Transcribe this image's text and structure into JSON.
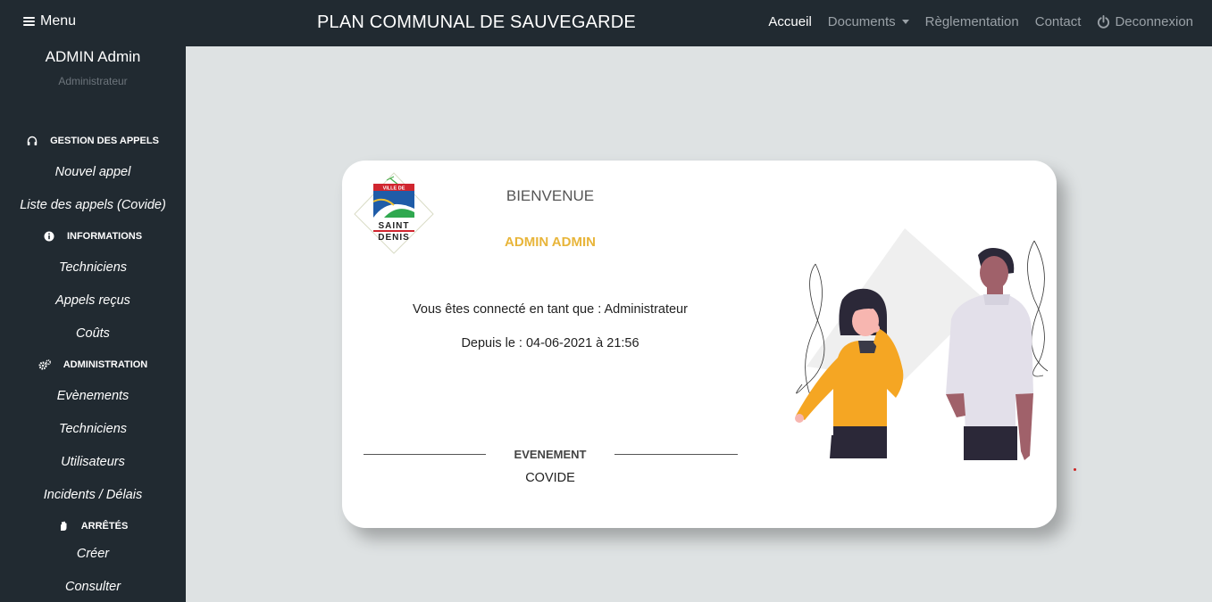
{
  "navbar": {
    "menu_label": "Menu",
    "brand": "PLAN COMMUNAL DE SAUVEGARDE",
    "links": {
      "home": "Accueil",
      "documents": "Documents",
      "regulation": "Règlementation",
      "contact": "Contact",
      "logout": "Deconnexion"
    }
  },
  "sidebar": {
    "user_name": "ADMIN Admin",
    "user_role": "Administrateur",
    "sections": {
      "calls": {
        "title": "GESTION DES APPELS",
        "icon": "headphones-icon",
        "items": [
          "Nouvel appel",
          "Liste des appels (Covide)"
        ]
      },
      "info": {
        "title": "INFORMATIONS",
        "icon": "info-icon",
        "items": [
          "Techniciens",
          "Appels reçus",
          "Coûts"
        ]
      },
      "admin": {
        "title": "ADMINISTRATION",
        "icon": "gears-icon",
        "items": [
          "Evènements",
          "Techniciens",
          "Utilisateurs",
          "Incidents / Délais"
        ]
      },
      "decrees": {
        "title": "ARRÊTÉS",
        "icon": "hand-icon",
        "items": [
          "Créer",
          "Consulter"
        ]
      }
    }
  },
  "card": {
    "logo": {
      "top_text": "VILLE DE",
      "line1": "SAINT",
      "line2": "DENIS"
    },
    "welcome": "BIENVENUE",
    "admin_name": "ADMIN ADMIN",
    "connected_as": "Vous êtes connecté en tant que : Administrateur",
    "since": "Depuis le : 04-06-2021 à 21:56",
    "event_title": "EVENEMENT",
    "event_value": "COVIDE"
  },
  "colors": {
    "navbar_bg": "#212a31",
    "page_bg": "#dee2e3",
    "accent_yellow": "#e8b53a",
    "sweater_yellow": "#f5a623"
  }
}
